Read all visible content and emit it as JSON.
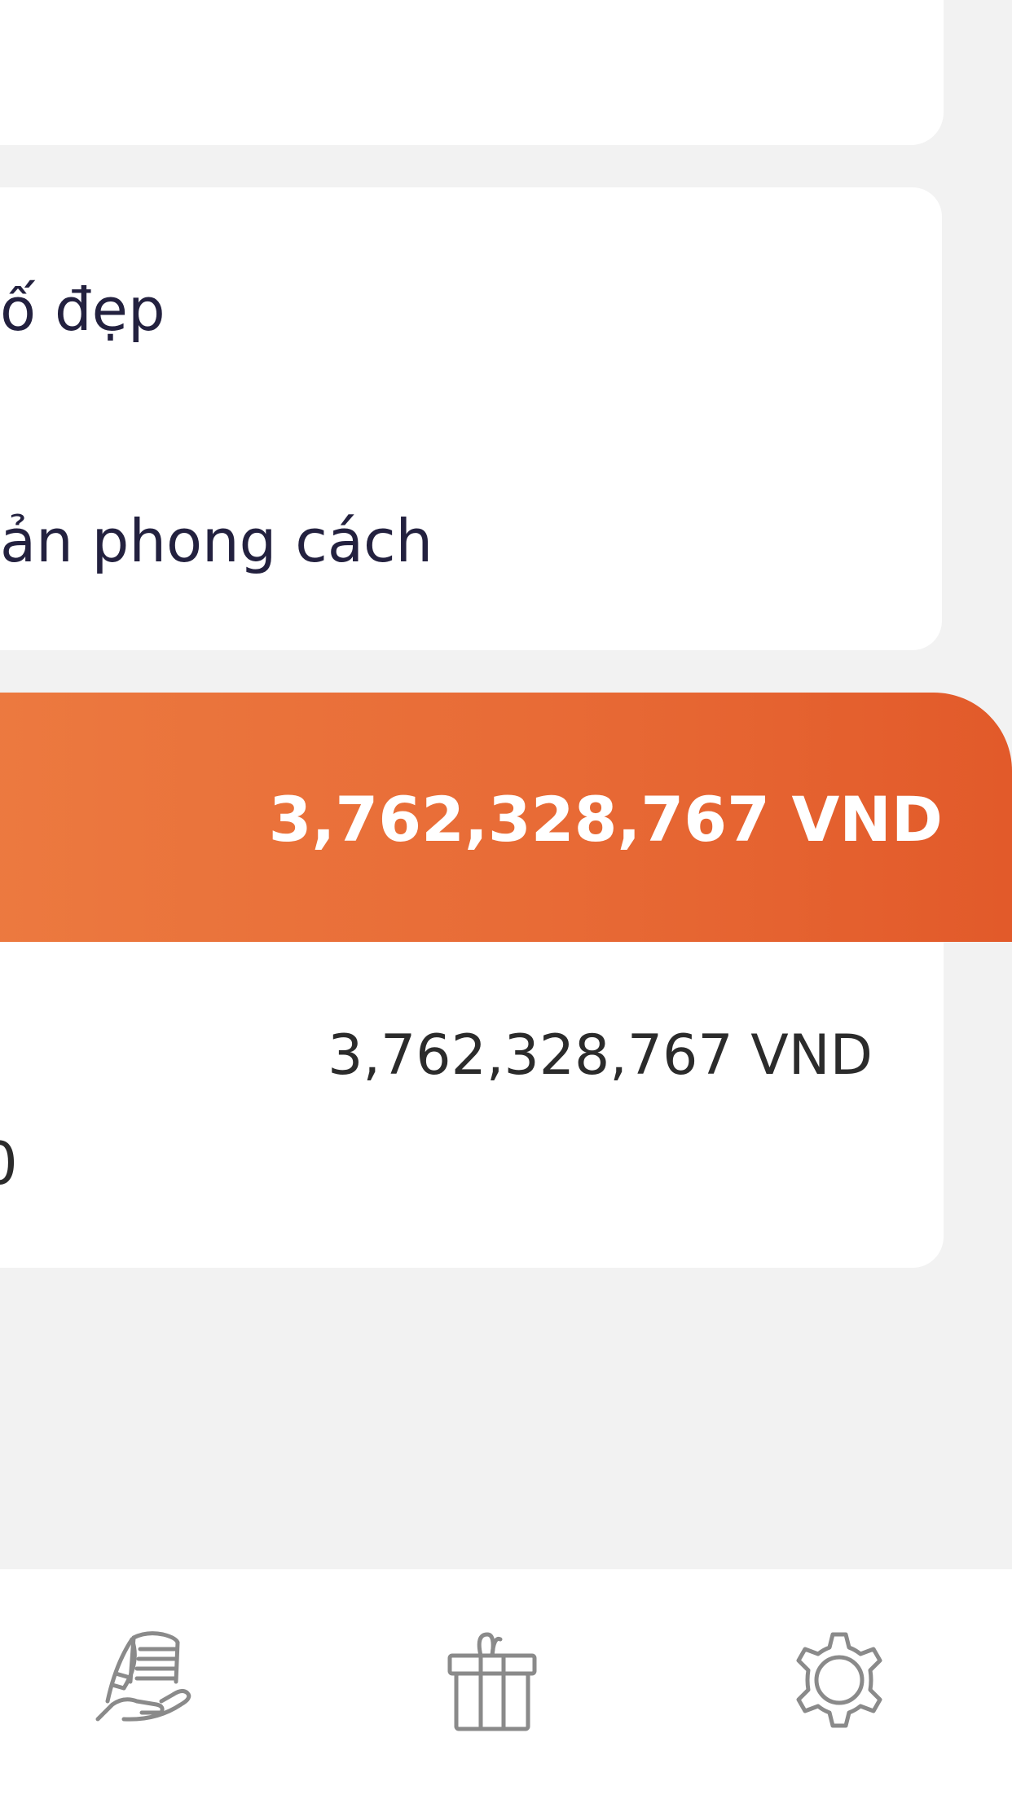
{
  "options": {
    "option_1": "ố đẹp",
    "option_2": "ản phong cách"
  },
  "total": {
    "amount": "3,762,328,767 VND",
    "color": "#e86b36"
  },
  "detail": {
    "amount": "3,762,328,767 VND",
    "fragment": "0"
  },
  "bottom_nav": {
    "items": [
      {
        "icon": "savings-hand-icon"
      },
      {
        "icon": "gift-icon"
      },
      {
        "icon": "gear-icon"
      }
    ]
  }
}
